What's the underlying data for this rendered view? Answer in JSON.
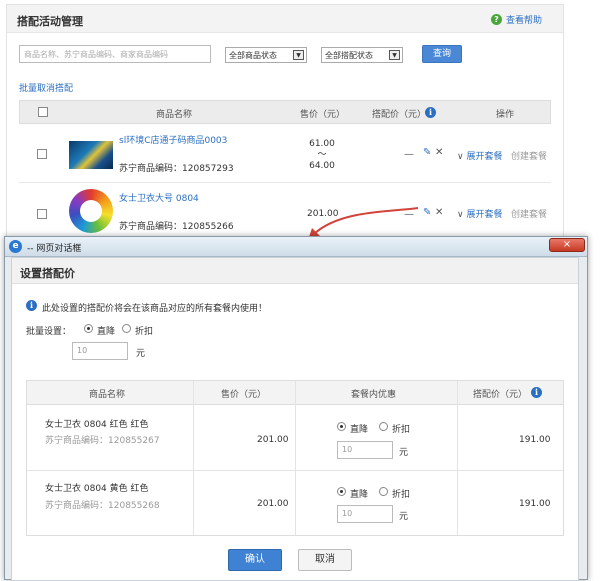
{
  "manager": {
    "title": "搭配活动管理",
    "help": "查看帮助",
    "search_placeholder": "商品名称、苏宁商品编码、商家商品编码",
    "status_select": "全部商品状态",
    "bundle_select": "全部搭配状态",
    "query": "查询",
    "batch_cancel": "批量取消搭配",
    "columns": [
      "商品名称",
      "售价（元）",
      "搭配价（元）",
      "操作"
    ],
    "rows": [
      {
        "name": "sl环境C店通子码商品0003",
        "code_label": "苏宁商品编码：",
        "code": "120857293",
        "price_low": "61.00",
        "price_sep": "～",
        "price_high": "64.00",
        "expand": "展开套餐",
        "create": "创建套餐"
      },
      {
        "name": "女士卫衣大号 0804",
        "code_label": "苏宁商品编码：",
        "code": "120855266",
        "price": "201.00",
        "expand": "展开套餐",
        "create": "创建套餐"
      }
    ]
  },
  "dialog": {
    "window_title": "-- 网页对话框",
    "close": "×",
    "title": "设置搭配价",
    "notice": "此处设置的搭配价将会在该商品对应的所有套餐内使用！",
    "batch_label": "批量设置：",
    "opt_direct": "直降",
    "opt_discount": "折扣",
    "batch_value": "10",
    "unit": "元",
    "columns": [
      "商品名称",
      "售价（元）",
      "套餐内优惠",
      "搭配价（元）"
    ],
    "rows": [
      {
        "name": "女士卫衣 0804 红色 红色",
        "code_label": "苏宁商品编码：",
        "code": "120855267",
        "price": "201.00",
        "value": "10",
        "bundle_price": "191.00"
      },
      {
        "name": "女士卫衣 0804 黄色 红色",
        "code_label": "苏宁商品编码：",
        "code": "120855268",
        "price": "201.00",
        "value": "10",
        "bundle_price": "191.00"
      }
    ],
    "confirm": "确认",
    "cancel": "取消"
  },
  "colors": {
    "link": "#2b6fc2",
    "primary": "#3f82d4",
    "arrow": "#d2433b"
  }
}
